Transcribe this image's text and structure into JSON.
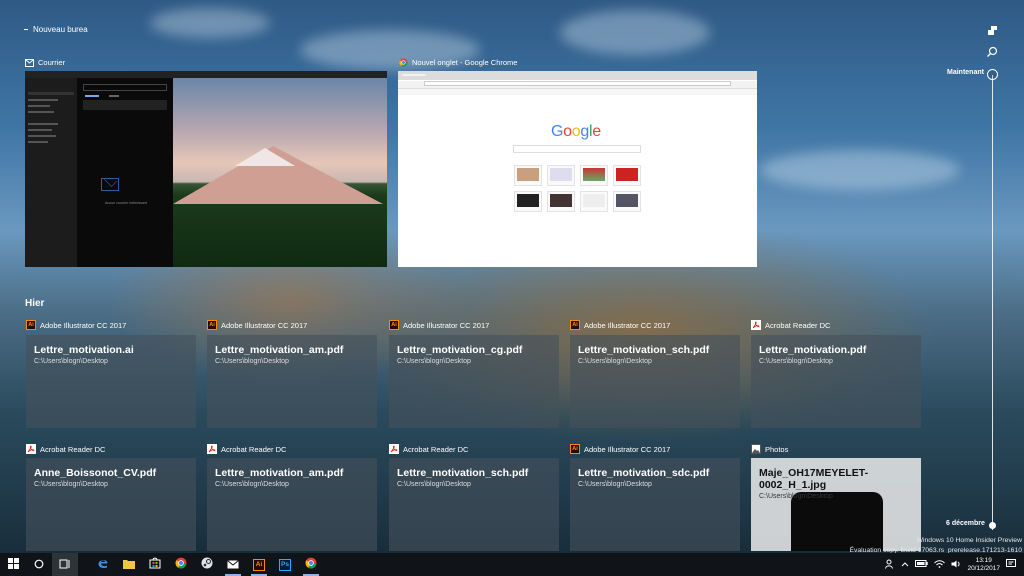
{
  "desktop": {
    "label": "Nouveau burea"
  },
  "open_windows": [
    {
      "app": "Courrier",
      "icon": "mail-icon"
    },
    {
      "app": "Nouvel onglet - Google Chrome",
      "icon": "chrome-icon"
    }
  ],
  "mail_preview": {
    "empty_text": "Aucun courrier intéressant"
  },
  "chrome_preview": {
    "logo": "Google"
  },
  "timeline": {
    "section_label": "Hier",
    "now_label": "Maintenant",
    "date_label": "6 décembre",
    "rows": [
      [
        {
          "app": "Adobe Illustrator CC 2017",
          "type": "ai",
          "file": "Lettre_motivation.ai",
          "path": "C:\\Users\\blogn\\Desktop"
        },
        {
          "app": "Adobe Illustrator CC 2017",
          "type": "ai",
          "file": "Lettre_motivation_am.pdf",
          "path": "C:\\Users\\blogn\\Desktop"
        },
        {
          "app": "Adobe Illustrator CC 2017",
          "type": "ai",
          "file": "Lettre_motivation_cg.pdf",
          "path": "C:\\Users\\blogn\\Desktop"
        },
        {
          "app": "Adobe Illustrator CC 2017",
          "type": "ai",
          "file": "Lettre_motivation_sch.pdf",
          "path": "C:\\Users\\blogn\\Desktop"
        },
        {
          "app": "Acrobat Reader DC",
          "type": "pdf",
          "file": "Lettre_motivation.pdf",
          "path": "C:\\Users\\blogn\\Desktop"
        }
      ],
      [
        {
          "app": "Acrobat Reader DC",
          "type": "pdf",
          "file": "Anne_Boissonot_CV.pdf",
          "path": "C:\\Users\\blogn\\Desktop"
        },
        {
          "app": "Acrobat Reader DC",
          "type": "pdf",
          "file": "Lettre_motivation_am.pdf",
          "path": "C:\\Users\\blogn\\Desktop"
        },
        {
          "app": "Acrobat Reader DC",
          "type": "pdf",
          "file": "Lettre_motivation_sch.pdf",
          "path": "C:\\Users\\blogn\\Desktop"
        },
        {
          "app": "Adobe Illustrator CC 2017",
          "type": "ai",
          "file": "Lettre_motivation_sdc.pdf",
          "path": "C:\\Users\\blogn\\Desktop"
        },
        {
          "app": "Photos",
          "type": "photo",
          "file": "Maje_OH17MEYELET-0002_H_1.jpg",
          "path": "C:\\Users\\blogn\\Desktop"
        }
      ]
    ]
  },
  "watermark": {
    "line1": "Windows 10 Home Insider Preview",
    "line2": "Évaluation copy. Build 17063.rs_prerelease.171213-1610"
  },
  "taskbar": {
    "time": "13:19",
    "date": "20/12/2017",
    "apps": [
      "windows-logo-icon",
      "cortana-icon",
      "task-view-icon",
      "edge-icon",
      "file-explorer-icon",
      "store-icon",
      "chrome-icon",
      "steam-icon",
      "mail-icon",
      "illustrator-icon",
      "photoshop-icon",
      "chrome-icon"
    ]
  },
  "colors": {
    "illustrator": "#ff8a00",
    "acrobat": "#d21",
    "accent": "#8cb4e6"
  }
}
